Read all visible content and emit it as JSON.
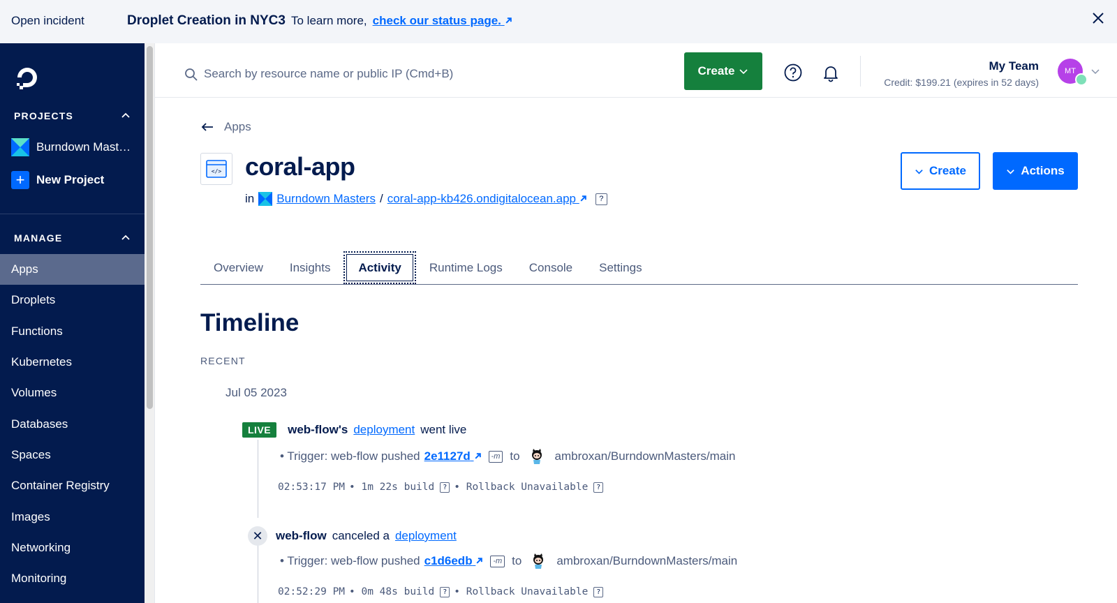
{
  "banner": {
    "tag": "Open incident",
    "title": "Droplet Creation in NYC3",
    "text": "To learn more,",
    "link": "check our status page."
  },
  "sidebar": {
    "projects_heading": "PROJECTS",
    "projects": [
      {
        "label": "Burndown Masters"
      },
      {
        "label": "New Project"
      }
    ],
    "manage_heading": "MANAGE",
    "nav": [
      {
        "label": "Apps",
        "active": true
      },
      {
        "label": "Droplets"
      },
      {
        "label": "Functions"
      },
      {
        "label": "Kubernetes"
      },
      {
        "label": "Volumes"
      },
      {
        "label": "Databases"
      },
      {
        "label": "Spaces"
      },
      {
        "label": "Container Registry"
      },
      {
        "label": "Images"
      },
      {
        "label": "Networking"
      },
      {
        "label": "Monitoring"
      }
    ]
  },
  "header": {
    "search_placeholder": "Search by resource name or public IP (Cmd+B)",
    "create_label": "Create",
    "team_name": "My Team",
    "credit": "Credit: $199.21 (expires in 52 days)",
    "avatar_initials": "MT"
  },
  "page": {
    "breadcrumb": "Apps",
    "title": "coral-app",
    "in_label": "in",
    "project_link": "Burndown Masters",
    "separator": "/",
    "domain_link": "coral-app-kb426.ondigitalocean.app",
    "create_button": "Create",
    "actions_button": "Actions",
    "tabs": [
      "Overview",
      "Insights",
      "Activity",
      "Runtime Logs",
      "Console",
      "Settings"
    ],
    "active_tab": "Activity"
  },
  "timeline": {
    "title": "Timeline",
    "section": "RECENT",
    "date": "Jul 05 2023",
    "events": [
      {
        "badge": "LIVE",
        "actor": "web-flow's",
        "link": "deployment",
        "suffix": "went live",
        "trigger_prefix": "• Trigger: web-flow pushed",
        "commit": "2e1127d",
        "flag": "-m",
        "to": "to",
        "repo": "ambroxan/BurndownMasters/main",
        "time": "02:53:17 PM",
        "build": "• 1m 22s build",
        "rollback": "• Rollback Unavailable"
      },
      {
        "actor": "web-flow",
        "middle": "canceled a",
        "link": "deployment",
        "trigger_prefix": "• Trigger: web-flow pushed",
        "commit": "c1d6edb",
        "flag": "-m",
        "to": "to",
        "repo": "ambroxan/BurndownMasters/main",
        "time": "02:52:29 PM",
        "build": "• 0m 48s build",
        "rollback": "• Rollback Unavailable"
      }
    ]
  },
  "colors": {
    "navy": "#031b4e",
    "blue": "#0069ff",
    "green": "#15803d",
    "active_nav": "#5b6a8d"
  }
}
